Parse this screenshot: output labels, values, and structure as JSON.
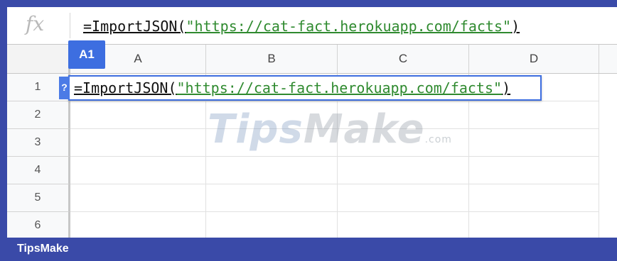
{
  "formula_bar": {
    "icon": "fx-icon",
    "formula_function": "=ImportJSON(",
    "formula_string": "\"https://cat-fact.herokuapp.com/facts\"",
    "formula_close": ")"
  },
  "name_box": {
    "value": "A1"
  },
  "columns": [
    {
      "label": "A"
    },
    {
      "label": "B"
    },
    {
      "label": "C"
    },
    {
      "label": "D"
    }
  ],
  "rows": [
    {
      "label": "1"
    },
    {
      "label": "2"
    },
    {
      "label": "3"
    },
    {
      "label": "4"
    },
    {
      "label": "5"
    },
    {
      "label": "6"
    }
  ],
  "cell_editor": {
    "help_icon": "?",
    "formula_function": "=ImportJSON(",
    "formula_string": "\"https://cat-fact.herokuapp.com/facts\"",
    "formula_close": ")"
  },
  "watermark": {
    "tips": "Tips",
    "make": "Make",
    "com": ".com"
  },
  "footer": {
    "label": "TipsMake"
  },
  "colors": {
    "accent": "#3d6ee0",
    "string_literal": "#2f8a2f",
    "frame_border": "#3a4aa8"
  }
}
